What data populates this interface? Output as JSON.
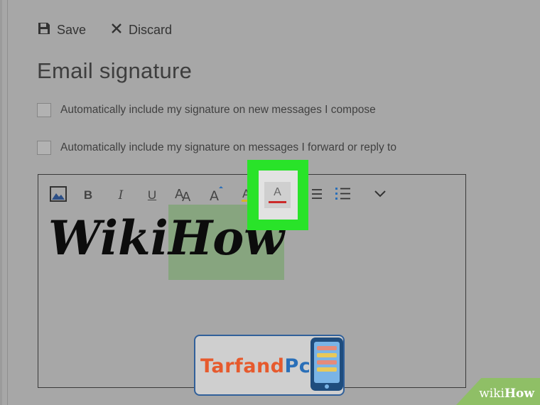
{
  "toolbar": {
    "save_label": "Save",
    "discard_label": "Discard",
    "save_icon": "save-icon",
    "discard_icon": "close-icon"
  },
  "page": {
    "title": "Email signature"
  },
  "options": [
    {
      "label": "Automatically include my signature on new messages I compose",
      "checked": false
    },
    {
      "label": "Automatically include my signature on messages I forward or reply to",
      "checked": false
    }
  ],
  "format_toolbar": {
    "buttons": [
      {
        "name": "insert-picture",
        "icon": "image-icon"
      },
      {
        "name": "bold",
        "label": "B"
      },
      {
        "name": "italic",
        "label": "I"
      },
      {
        "name": "underline",
        "label": "U"
      },
      {
        "name": "font-size",
        "icon": "font-size-icon"
      },
      {
        "name": "grow-font",
        "icon": "increase-font-icon"
      },
      {
        "name": "highlight",
        "icon": "highlight-icon"
      },
      {
        "name": "font-color",
        "label": "A",
        "color": "#cc2a2a"
      },
      {
        "name": "bullets",
        "icon": "bullets-icon"
      },
      {
        "name": "numbering",
        "icon": "numbering-icon"
      },
      {
        "name": "more",
        "icon": "chevron-down-icon"
      }
    ]
  },
  "signature": {
    "plain": "Wiki",
    "selected": "How"
  },
  "colors": {
    "background": "#a7a7a7",
    "highlight": "#29e329",
    "selection": "#87a57f",
    "font_color": "#cc2a2a"
  },
  "watermark": {
    "part1": "Tarfand",
    "part2": "Pc",
    "color1": "#e65a2d",
    "color2": "#2a6fb8"
  },
  "brand": {
    "wiki": "wiki",
    "how": "How"
  }
}
